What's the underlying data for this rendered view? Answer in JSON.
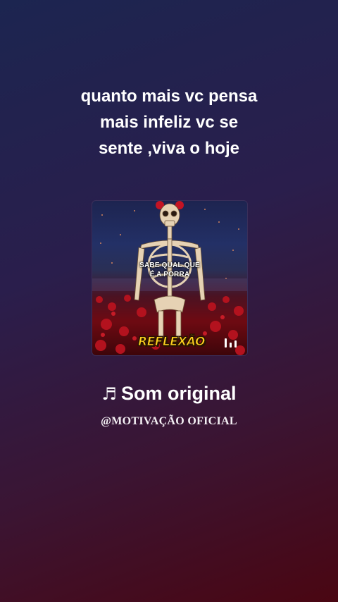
{
  "caption": {
    "lines": [
      "quanto mais vc pensa",
      "mais infeliz vc se",
      "sente ,viva o hoje"
    ]
  },
  "cover": {
    "overlay_text": [
      "SABE QUAL QUE",
      "É A PORRA"
    ],
    "badge": "REFLEXÃO",
    "icon": "audio-bars-icon"
  },
  "sound": {
    "note_icon": "♬",
    "title": "Som original",
    "author": "@MOTIVAÇÃO OFICIAL"
  }
}
